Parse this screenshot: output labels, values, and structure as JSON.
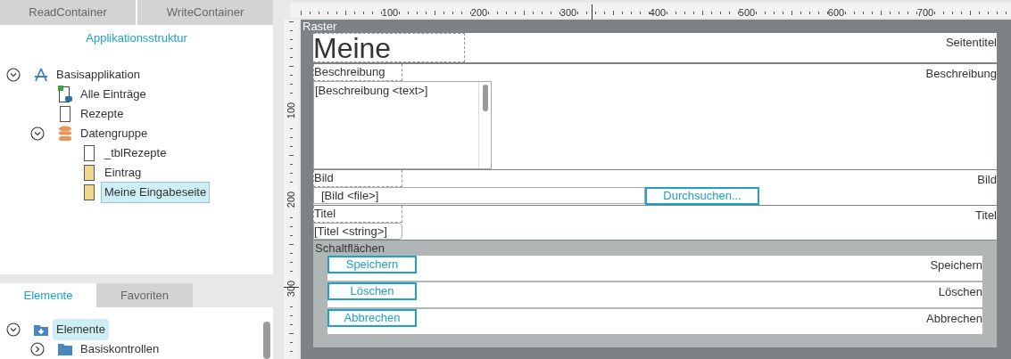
{
  "container_tabs": [
    {
      "label": "ReadContainer",
      "selected": false
    },
    {
      "label": "WriteContainer",
      "selected": false
    }
  ],
  "structure": {
    "title": "Applikationsstruktur",
    "tree": [
      {
        "label": "Basisapplikation",
        "kind": "app",
        "expanded": true,
        "selected": false,
        "children": [
          {
            "label": "Alle Einträge",
            "kind": "view",
            "selected": false
          },
          {
            "label": "Rezepte",
            "kind": "page",
            "selected": false
          },
          {
            "label": "Datengruppe",
            "kind": "datagroup",
            "expanded": true,
            "selected": false,
            "children": [
              {
                "label": "_tblRezepte",
                "kind": "page",
                "selected": false
              },
              {
                "label": "Eintrag",
                "kind": "form",
                "selected": false
              },
              {
                "label": "Meine Eingabeseite",
                "kind": "form",
                "selected": true
              }
            ]
          }
        ]
      }
    ]
  },
  "palette_tabs": [
    {
      "label": "Elemente",
      "selected": true
    },
    {
      "label": "Favoriten",
      "selected": false
    }
  ],
  "palette": {
    "tree": [
      {
        "label": "Elemente",
        "kind": "elements",
        "expanded": true,
        "selected": true,
        "children": [
          {
            "label": "Basiskontrollen",
            "kind": "folder",
            "expanded": false,
            "selected": false
          }
        ]
      }
    ]
  },
  "ruler": {
    "horizontal": [
      "100",
      "200",
      "300",
      "400",
      "500",
      "600",
      "700"
    ],
    "vertical": [
      "100",
      "200",
      "300"
    ]
  },
  "canvas": {
    "label": "Raster",
    "rows": [
      {
        "kind": "heading",
        "value": "Meine",
        "caption": "Seitentitel"
      },
      {
        "kind": "textarea",
        "label": "Beschreibung",
        "value": "[Beschreibung <text>]",
        "caption": "Beschreibung"
      },
      {
        "kind": "file",
        "label": "Bild",
        "value": "[Bild <file>]",
        "button": "Durchsuchen...",
        "caption": "Bild"
      },
      {
        "kind": "text",
        "label": "Titel",
        "value": "[Titel <string>]",
        "caption": "Titel"
      },
      {
        "kind": "group",
        "label": "Schaltflächen",
        "buttons": [
          {
            "label": "Speichern",
            "caption": "Speichern"
          },
          {
            "label": "Löschen",
            "caption": "Löschen"
          },
          {
            "label": "Abbrechen",
            "caption": "Abbrechen"
          }
        ]
      }
    ]
  }
}
